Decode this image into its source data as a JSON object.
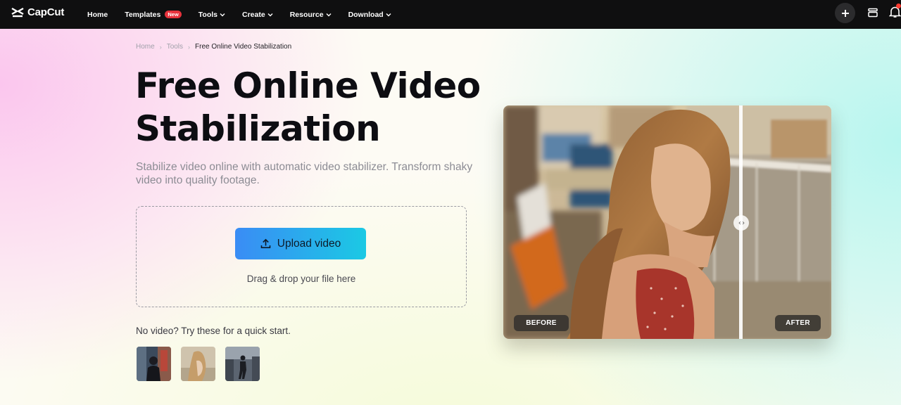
{
  "nav": {
    "logo_text": "CapCut",
    "items": [
      {
        "label": "Home",
        "has_chevron": false
      },
      {
        "label": "Templates",
        "badge": "New",
        "has_chevron": false
      },
      {
        "label": "Tools",
        "has_chevron": true
      },
      {
        "label": "Create",
        "has_chevron": true
      },
      {
        "label": "Resource",
        "has_chevron": true
      },
      {
        "label": "Download",
        "has_chevron": true
      }
    ],
    "icons": [
      "plus-icon",
      "stack-icon",
      "bell-icon"
    ]
  },
  "breadcrumb": {
    "items": [
      "Home",
      "Tools"
    ],
    "current": "Free Online Video Stabilization"
  },
  "hero": {
    "title": "Free Online Video Stabilization",
    "subtitle": "Stabilize video online with automatic video stabilizer. Transform shaky video into quality footage."
  },
  "upload": {
    "button_label": "Upload video",
    "drop_text": "Drag & drop your file here"
  },
  "quick_start": {
    "label": "No video? Try these for a quick start."
  },
  "preview": {
    "before_label": "BEFORE",
    "after_label": "AFTER"
  },
  "colors": {
    "nav_bg": "#0f0f10",
    "badge_red": "#e6323c",
    "upload_gradient_start": "#3a8cf5",
    "upload_gradient_end": "#1bc9e4"
  }
}
